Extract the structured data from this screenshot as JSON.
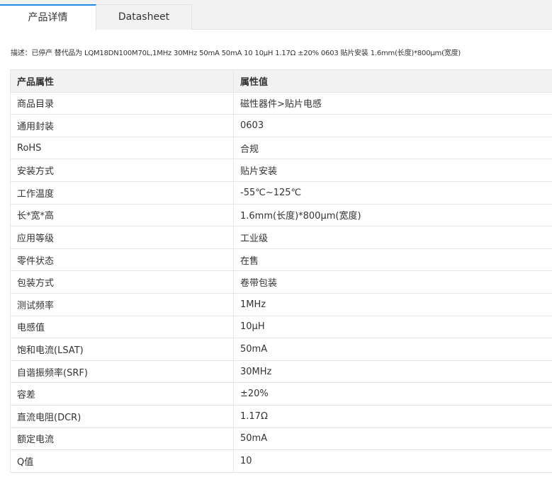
{
  "tabs": {
    "product_details": "产品详情",
    "datasheet": "Datasheet"
  },
  "description": "描述：已停产 替代品为 LQM18DN100M70L,1MHz 30MHz 50mA 50mA 10 10μH 1.17Ω ±20% 0603 贴片安装 1.6mm(长度)*800μm(宽度)",
  "table": {
    "headers": [
      "产品属性",
      "属性值"
    ],
    "rows": [
      [
        "商品目录",
        "磁性器件>贴片电感"
      ],
      [
        "通用封装",
        "0603"
      ],
      [
        "RoHS",
        "合规"
      ],
      [
        "安装方式",
        "贴片安装"
      ],
      [
        "工作温度",
        "-55℃~125℃"
      ],
      [
        "长*宽*高",
        "1.6mm(长度)*800μm(宽度)"
      ],
      [
        "应用等级",
        "工业级"
      ],
      [
        "零件状态",
        "在售"
      ],
      [
        "包装方式",
        "卷带包装"
      ],
      [
        "测试频率",
        "1MHz"
      ],
      [
        "电感值",
        "10μH"
      ],
      [
        "饱和电流(LSAT)",
        "50mA"
      ],
      [
        "自谐振频率(SRF)",
        "30MHz"
      ],
      [
        "容差",
        "±20%"
      ],
      [
        "直流电阻(DCR)",
        "1.17Ω"
      ],
      [
        "额定电流",
        "50mA"
      ],
      [
        "Q值",
        "10"
      ]
    ]
  },
  "colors": {
    "accent": "#1e8ae8",
    "header_bg": "#f2f2f2",
    "border": "#e6e6e6"
  }
}
